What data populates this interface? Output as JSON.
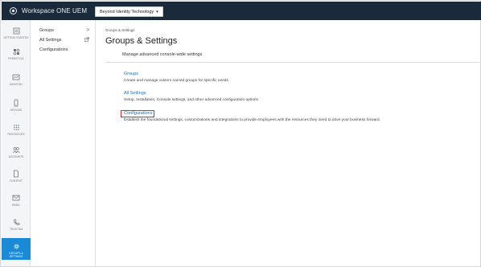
{
  "app": {
    "title": "Workspace ONE UEM",
    "org_selector": "Beyond Identity Technology"
  },
  "left_nav": [
    {
      "label": "GETTING STARTED",
      "icon": "getting-started-icon"
    },
    {
      "label": "FREESTYLE",
      "icon": "freestyle-icon"
    },
    {
      "label": "MONITOR",
      "icon": "monitor-icon"
    },
    {
      "label": "DEVICES",
      "icon": "devices-icon"
    },
    {
      "label": "RESOURCES",
      "icon": "resources-icon"
    },
    {
      "label": "ACCOUNTS",
      "icon": "accounts-icon"
    },
    {
      "label": "CONTENT",
      "icon": "content-icon"
    },
    {
      "label": "EMAIL",
      "icon": "email-icon"
    },
    {
      "label": "TELECOM",
      "icon": "telecom-icon"
    },
    {
      "label": "GROUPS & SETTINGS",
      "icon": "gear-icon",
      "active": true
    }
  ],
  "sub_nav": [
    {
      "label": "Groups",
      "trail": ">"
    },
    {
      "label": "All Settings",
      "trail": "external-link"
    },
    {
      "label": "Configurations",
      "trail": ""
    }
  ],
  "main": {
    "breadcrumb": "Groups & Settings",
    "title": "Groups & Settings",
    "section_title": "Manage advanced console-wide settings",
    "entries": [
      {
        "link": "Groups",
        "desc": "Create and manage custom named groups for specific needs"
      },
      {
        "link": "All Settings",
        "desc": "Setup, Installation, Console settings, and other advanced configuration options"
      },
      {
        "link": "Configurations",
        "desc": "Establish the foundational settings, customizations and integrations to provide employees with the resources they need to drive your business forward."
      }
    ]
  },
  "colors": {
    "topbar": "#1b2a3a",
    "active_nav": "#1a8ad6",
    "link": "#1a6fbf",
    "highlight": "#e3262c"
  }
}
